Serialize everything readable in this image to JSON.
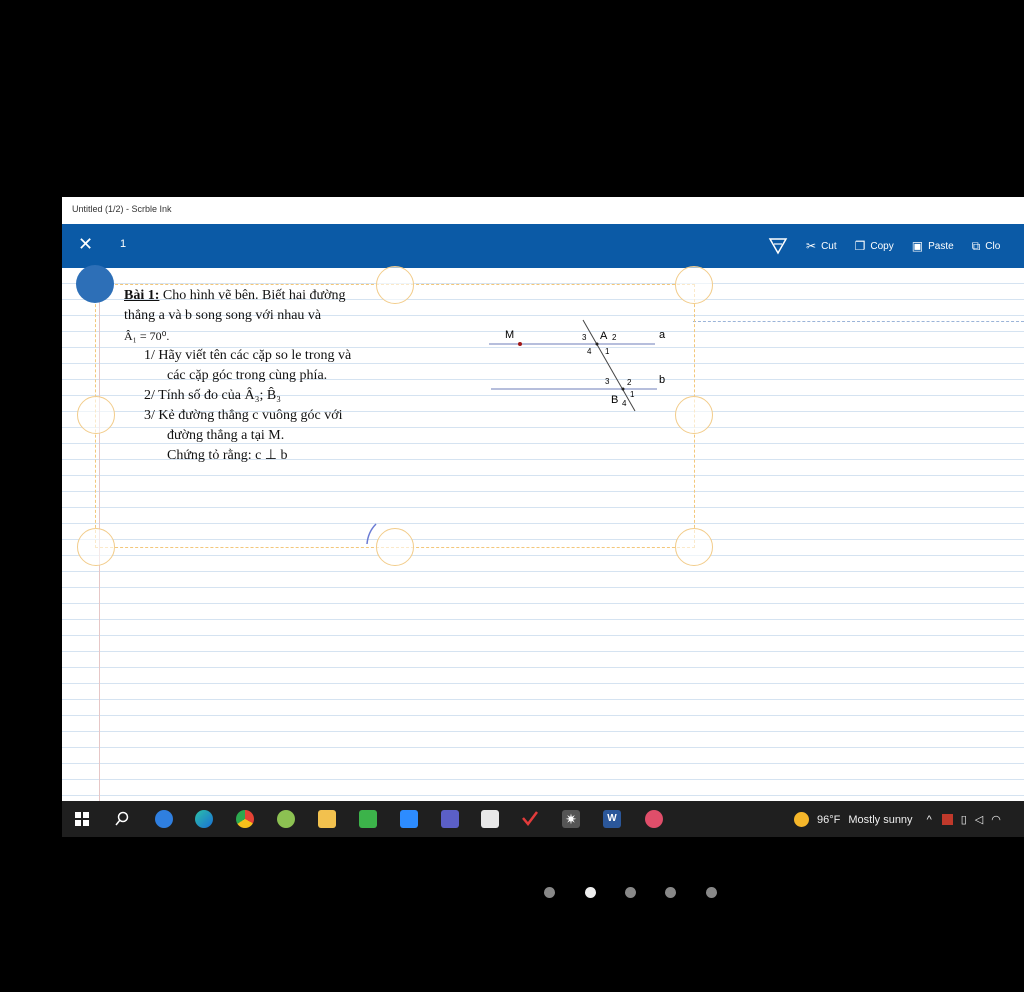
{
  "window": {
    "title": "Untitled (1/2) - Scrble Ink"
  },
  "toolbar": {
    "close_icon": "close-icon",
    "page_number": "1",
    "tools": [
      {
        "label": "",
        "icon": "lasso-select-icon"
      },
      {
        "label": "Cut",
        "icon": "scissors-icon"
      },
      {
        "label": "Copy",
        "icon": "copy-icon"
      },
      {
        "label": "Paste",
        "icon": "paste-icon"
      },
      {
        "label": "Clo",
        "icon": "clone-icon"
      }
    ]
  },
  "document": {
    "title": "Bài 1:",
    "lines": [
      "Cho hình vẽ bên.  Biết hai đường",
      "thẳng a và b song song với nhau và",
      "Â₁ = 70⁰.",
      "1/  Hãy viết tên các cặp so le trong và",
      "các cặp góc trong cùng phía.",
      "2/  Tính số đo của  Â₃; B̂₃",
      "3/  Kẻ đường thẳng c vuông góc với",
      "đường thẳng a tại M.",
      "Chứng tỏ rằng: c ⊥ b"
    ],
    "figure_labels": {
      "m": "M",
      "a": "a",
      "b": "b",
      "A": "A",
      "B": "B",
      "a1": "1",
      "a2": "2",
      "a3": "3",
      "a4": "4",
      "b1": "1",
      "b2": "2",
      "b3": "3",
      "b4": "4"
    }
  },
  "taskbar": {
    "apps": [
      "windows-start-icon",
      "search-icon",
      "zalo-icon",
      "edge-icon",
      "chrome-icon",
      "maps-icon",
      "file-explorer-icon",
      "camtasia-icon",
      "zoom-icon",
      "teams-icon",
      "apps-icon",
      "checkmark-app-icon",
      "sun-app-icon",
      "word-icon",
      "paint-icon"
    ],
    "weather": {
      "temp": "96°F",
      "condition": "Mostly sunny"
    }
  },
  "pager": {
    "count": 5,
    "active": 1
  },
  "colors": {
    "toolbar": "#0b5aa6",
    "selection": "#f3c77a",
    "taskbar": "#1f1f1f"
  }
}
